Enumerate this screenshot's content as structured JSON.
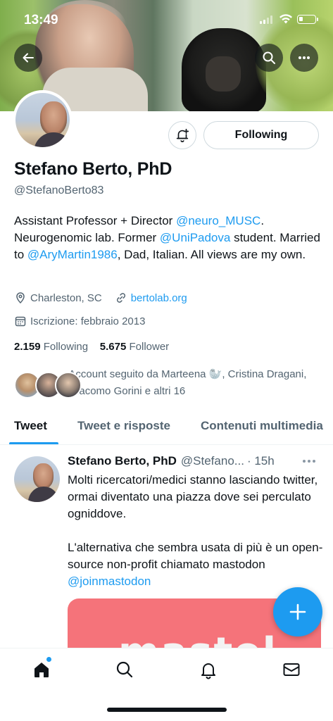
{
  "status_bar": {
    "time": "13:49"
  },
  "profile": {
    "name": "Stefano Berto, PhD",
    "handle": "@StefanoBerto83",
    "bio": {
      "p1": "Assistant Professor + Director ",
      "link1": "@neuro_MUSC",
      "p2": ". Neurogenomic lab. Former ",
      "link2": "@UniPadova",
      "p3": " student. Married to ",
      "link3": "@AryMartin1986",
      "p4": ", Dad, Italian. All views are my own."
    },
    "location": "Charleston, SC",
    "website": "bertolab.org",
    "joined": "Iscrizione: febbraio 2013",
    "following_count": "2.159",
    "following_label": "Following",
    "followers_count": "5.675",
    "followers_label": "Follower",
    "followed_by": "Account seguito da Marteena 🦭, Cristina Dragani, Giacomo Gorini e altri 16",
    "follow_button": "Following"
  },
  "tabs": [
    {
      "label": "Tweet",
      "active": true
    },
    {
      "label": "Tweet e risposte",
      "active": false
    },
    {
      "label": "Contenuti multimedia",
      "active": false
    }
  ],
  "tweet": {
    "author": "Stefano Berto, PhD",
    "handle": "@Stefano...",
    "time": "· 15h",
    "text_main": "Molti ricercatori/medici stanno lasciando twitter, ormai diventato una piazza dove sei perculato ogniddove.\n\nL'alternativa che sembra usata di più è un open-source non-profit chiamato mastodon ",
    "text_link": "@joinmastodon",
    "media_text": "mastol"
  },
  "colors": {
    "accent": "#1d9bf0",
    "text": "#0f1419",
    "muted": "#536471",
    "media_bg": "#f5737a"
  },
  "icons": {
    "back": "arrow-left-icon",
    "search": "search-icon",
    "more": "more-horizontal-icon",
    "notify": "bell-plus-icon",
    "location": "location-pin-icon",
    "link": "link-icon",
    "calendar": "calendar-icon",
    "compose": "plus-icon",
    "nav_home": "home-icon",
    "nav_search": "search-icon",
    "nav_notifications": "bell-icon",
    "nav_messages": "mail-icon"
  }
}
